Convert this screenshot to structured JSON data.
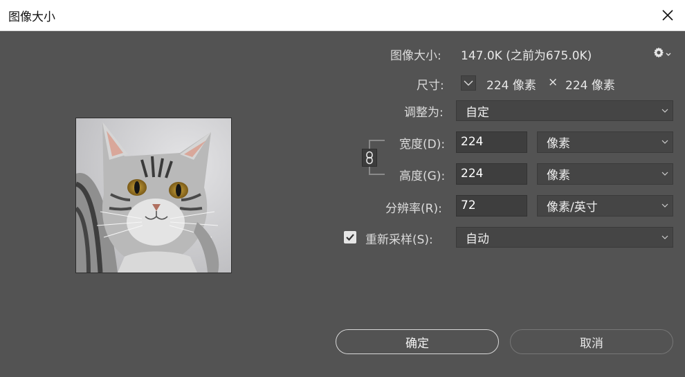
{
  "dialog": {
    "title": "图像大小"
  },
  "info": {
    "image_size_label": "图像大小:",
    "image_size_value": "147.0K (之前为675.0K)",
    "dimensions_label": "尺寸:",
    "width_value": "224 像素",
    "times": "×",
    "height_value": "224 像素"
  },
  "fit_to": {
    "label": "调整为:",
    "value": "自定"
  },
  "width": {
    "label": "宽度(D):",
    "value": "224",
    "unit": "像素"
  },
  "height": {
    "label": "高度(G):",
    "value": "224",
    "unit": "像素"
  },
  "resolution": {
    "label": "分辨率(R):",
    "value": "72",
    "unit": "像素/英寸"
  },
  "resample": {
    "label": "重新采样(S):",
    "checked": true,
    "value": "自动"
  },
  "buttons": {
    "ok": "确定",
    "cancel": "取消"
  },
  "icons": {
    "close": "close-icon",
    "settings": "gear-icon",
    "link": "chain-link-icon",
    "checkbox": "checkmark-icon",
    "dropdown": "chevron-down-icon"
  }
}
